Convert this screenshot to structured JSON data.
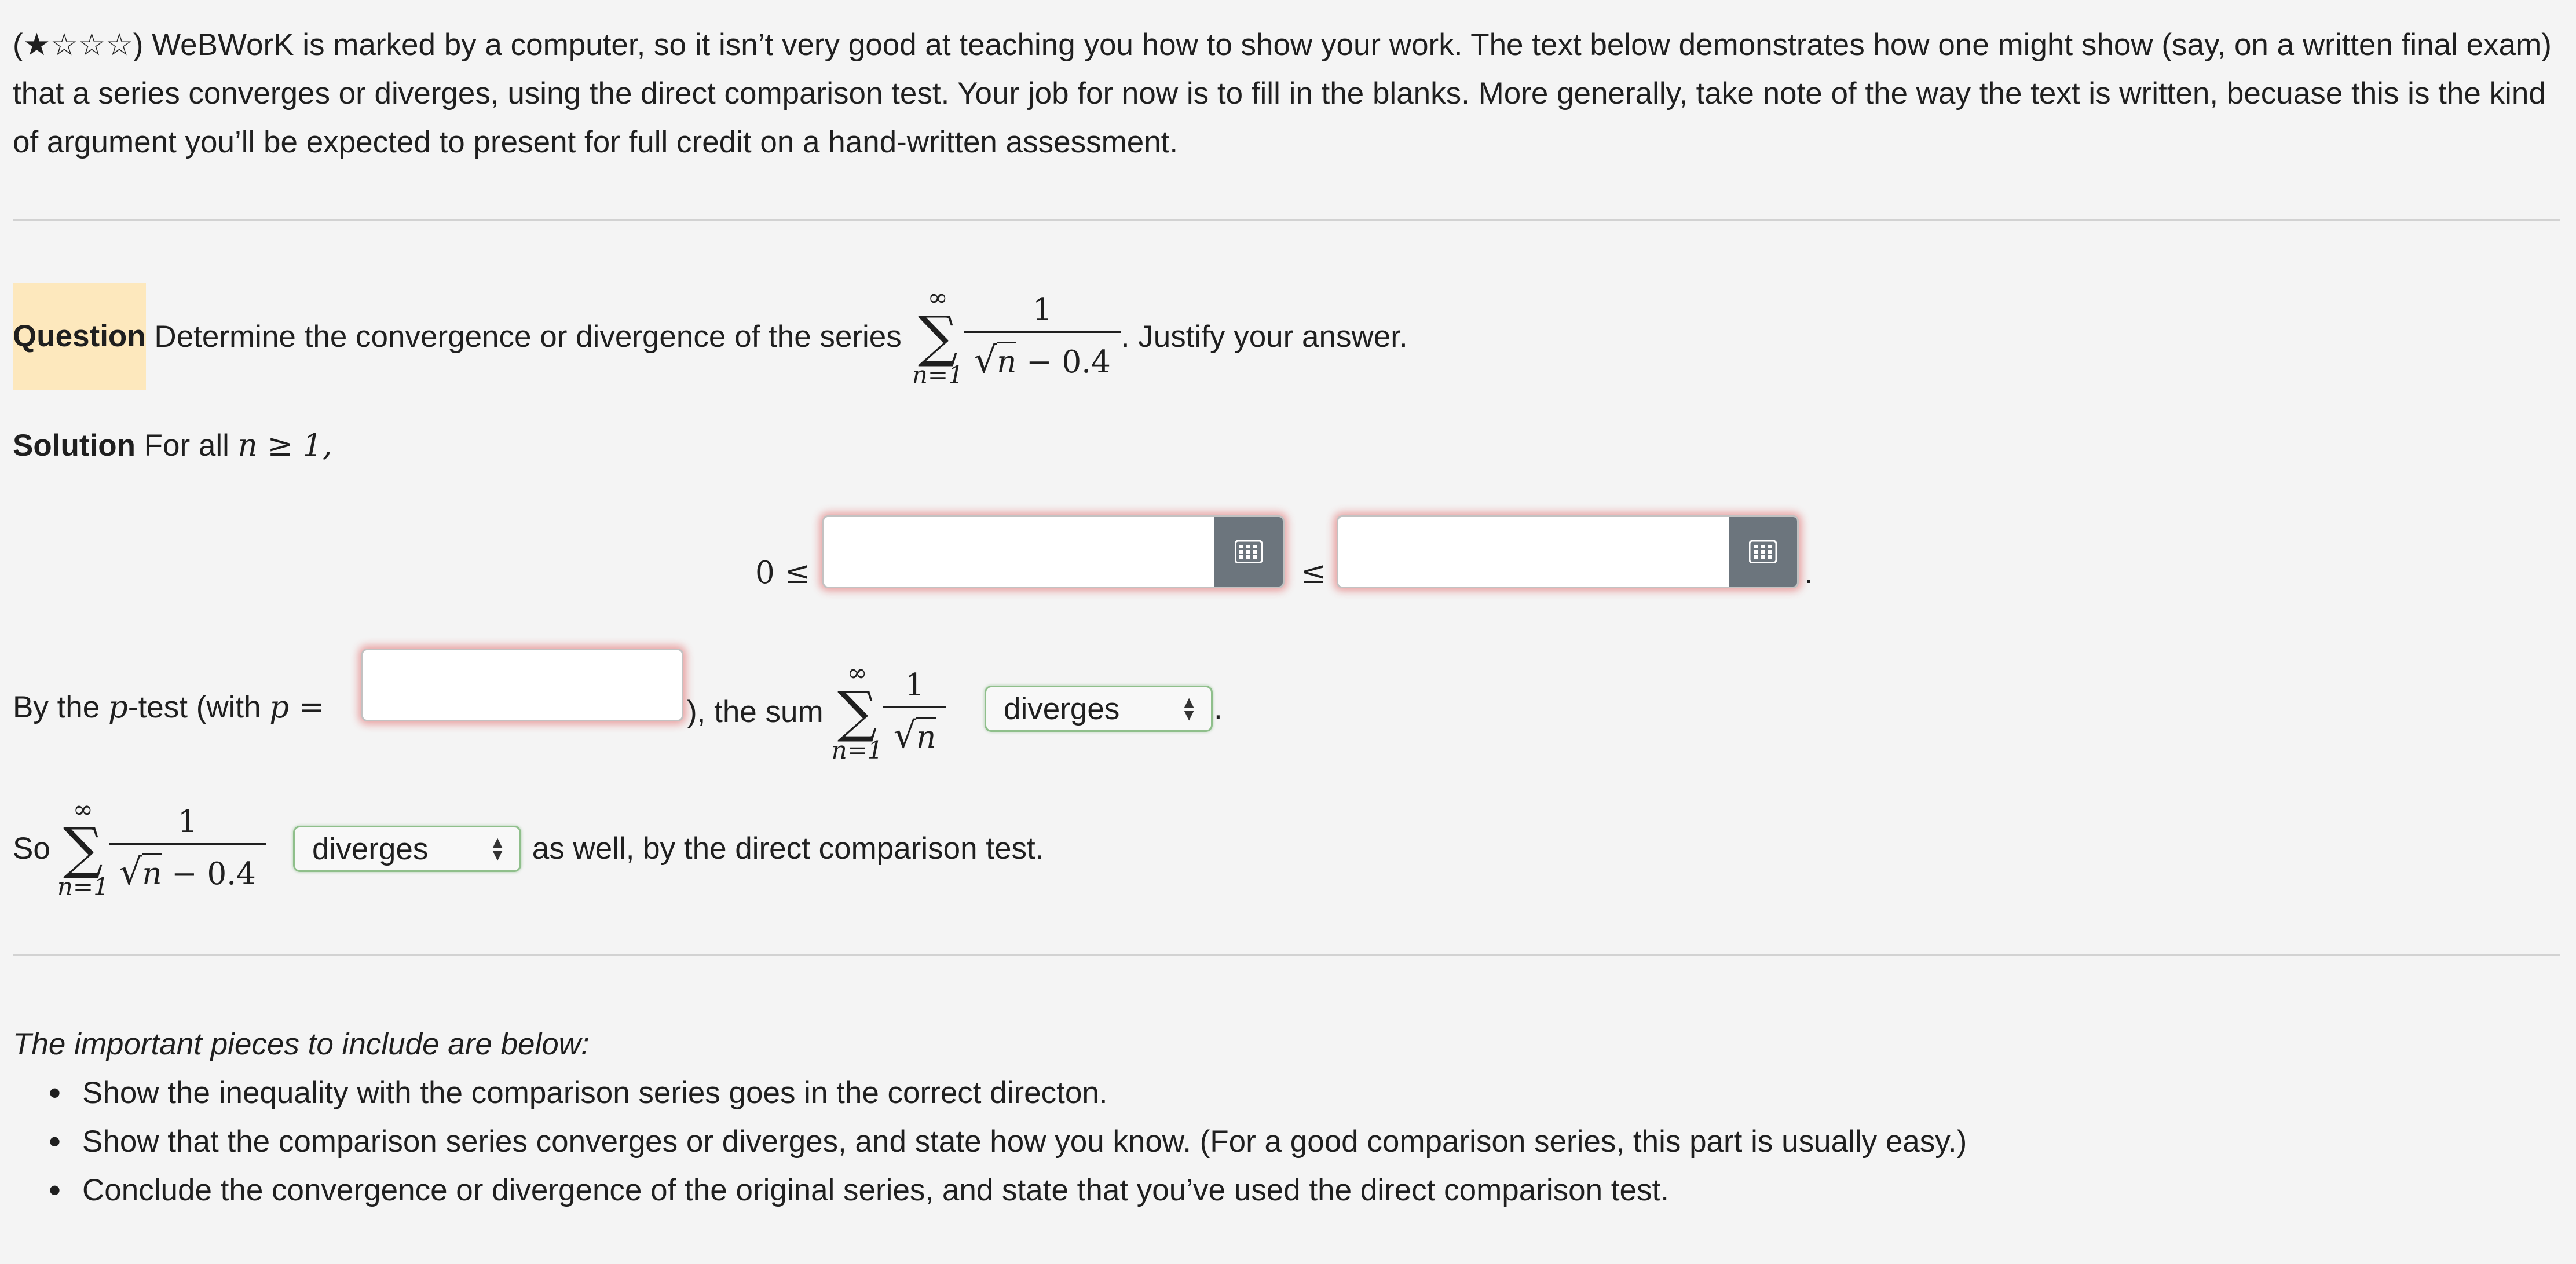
{
  "intro": {
    "stars": "(★☆☆☆)",
    "text": " WeBWorK is marked by a computer, so it isn’t very good at teaching you how to show your work. The text below demonstrates how one might show (say, on a written final exam) that a series converges or diverges, using the direct comparison test. Your job for now is to fill in the blanks. More generally, take note of the way the text is written, becuase this is the kind of argument you’ll be expected to present for full credit on a hand-written assessment."
  },
  "question": {
    "label": "Question",
    "text": " Determine the convergence or divergence of the series",
    "sum_upper": "∞",
    "sum_lower": "n=1",
    "numerator": "1",
    "radicand": "n",
    "den_tail": " − 0.4",
    "tail": ". Justify your answer."
  },
  "solution": {
    "label": "Solution",
    "text": " For all ",
    "cond": "n ≥ 1,"
  },
  "inequality": {
    "zero": "0 ≤",
    "le": "≤",
    "period": ".",
    "box1_value": "",
    "box2_value": ""
  },
  "ptest": {
    "prefix": "By the ",
    "p": "p",
    "mid": "-test (with ",
    "p2": "p",
    "eq": " =",
    "p_value": "",
    "after": "), the sum",
    "sum_upper": "∞",
    "sum_lower": "n=1",
    "numerator": "1",
    "radicand": "n",
    "select_value": "diverges",
    "period": "."
  },
  "conclusion": {
    "so": "So",
    "sum_upper": "∞",
    "sum_lower": "n=1",
    "numerator": "1",
    "radicand": "n",
    "den_tail": " − 0.4",
    "select_value": "diverges",
    "tail": " as well, by the direct comparison test."
  },
  "important": {
    "heading": "The important pieces to include are below:",
    "items": [
      "Show the inequality with the comparison series goes in the correct directon.",
      "Show that the comparison series converges or diverges, and state how you know. (For a good comparison series, this part is usually easy.)",
      "Conclude the convergence or divergence of the original series, and state that you’ve used the direct comparison test."
    ]
  },
  "icons": {
    "keyboard": "keyboard-icon",
    "select_arrows": "updown-arrows-icon"
  },
  "colors": {
    "question_highlight": "#fde8bd",
    "answer_glow": "#dc3c3c",
    "select_border": "#8fbf8b",
    "keyboard_button": "#6c757d"
  }
}
